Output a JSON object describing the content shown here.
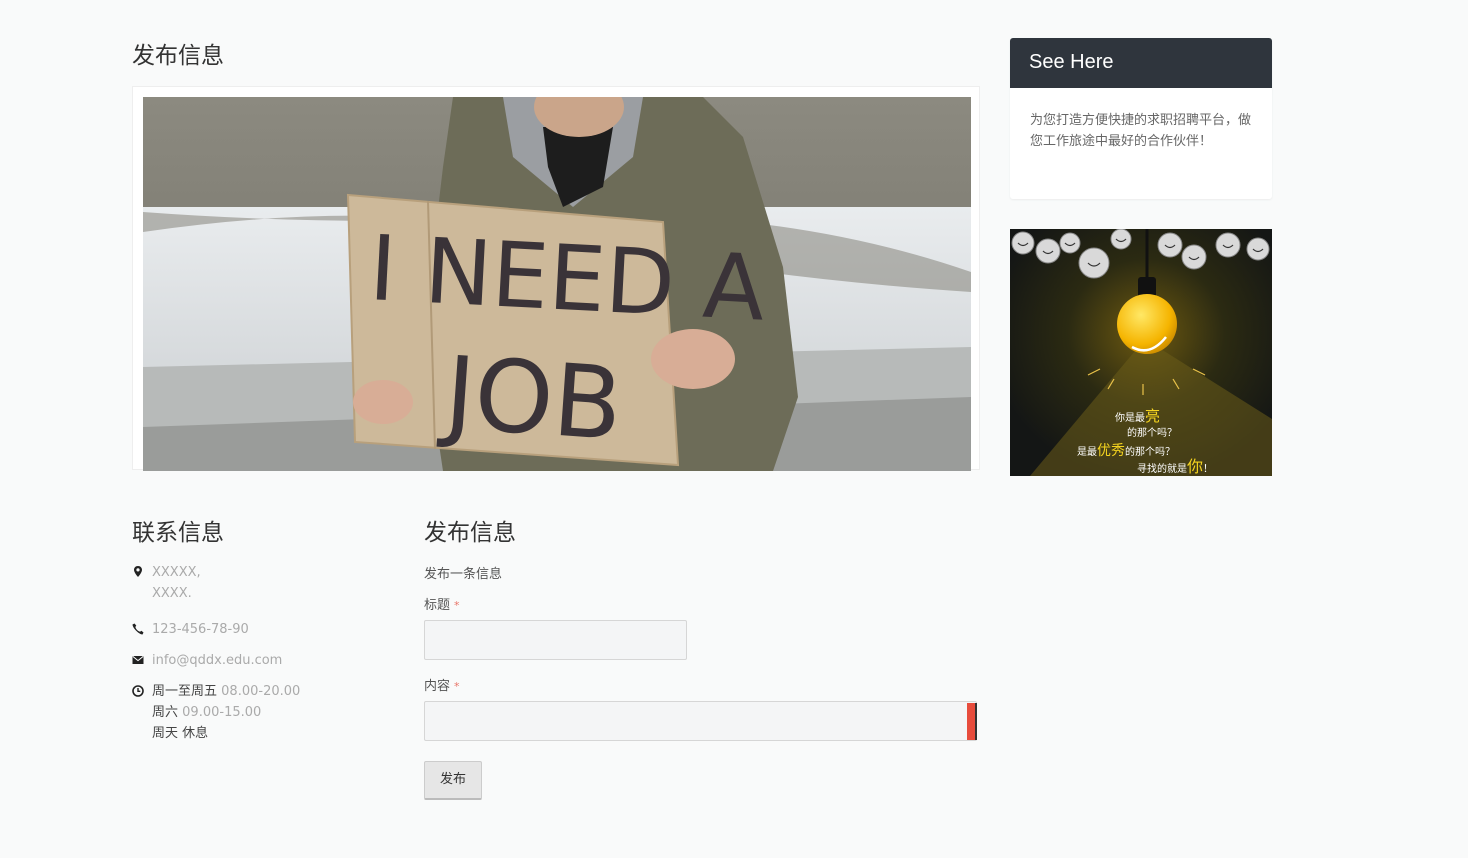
{
  "page": {
    "title": "发布信息"
  },
  "hero": {
    "sign_text_line1": "I NEED A",
    "sign_text_line2": "JOB"
  },
  "contact": {
    "title": "联系信息",
    "address_line1": "XXXXX,",
    "address_line2": "XXXX.",
    "phone": "123-456-78-90",
    "email": "info@qddx.edu.com",
    "hours": [
      {
        "day": "周一至周五",
        "time": "08.00-20.00"
      },
      {
        "day": "周六",
        "time": "09.00-15.00"
      },
      {
        "day": "周天",
        "time": "休息"
      }
    ]
  },
  "post_form": {
    "title": "发布信息",
    "lead": "发布一条信息",
    "title_label": "标题",
    "content_label": "内容",
    "required_mark": "*",
    "title_value": "",
    "content_value": "",
    "submit_label": "发布"
  },
  "sidebar": {
    "card_header": "See Here",
    "card_body": "为您打造方便快捷的求职招聘平台，做您工作旅途中最好的合作伙伴！",
    "ad": {
      "line1_a": "你是最",
      "line1_b": "亮",
      "line2": "的那个吗？",
      "line3_a": "是最",
      "line3_b": "优秀",
      "line3_c": "的那个吗？",
      "line4_a": "寻找的就是",
      "line4_b": "你",
      "line4_c": "！"
    }
  },
  "colors": {
    "page_bg": "#f9fafa",
    "card_header_bg": "#2f353d",
    "required": "#e87468",
    "ad_highlight": "#f5d41f"
  }
}
